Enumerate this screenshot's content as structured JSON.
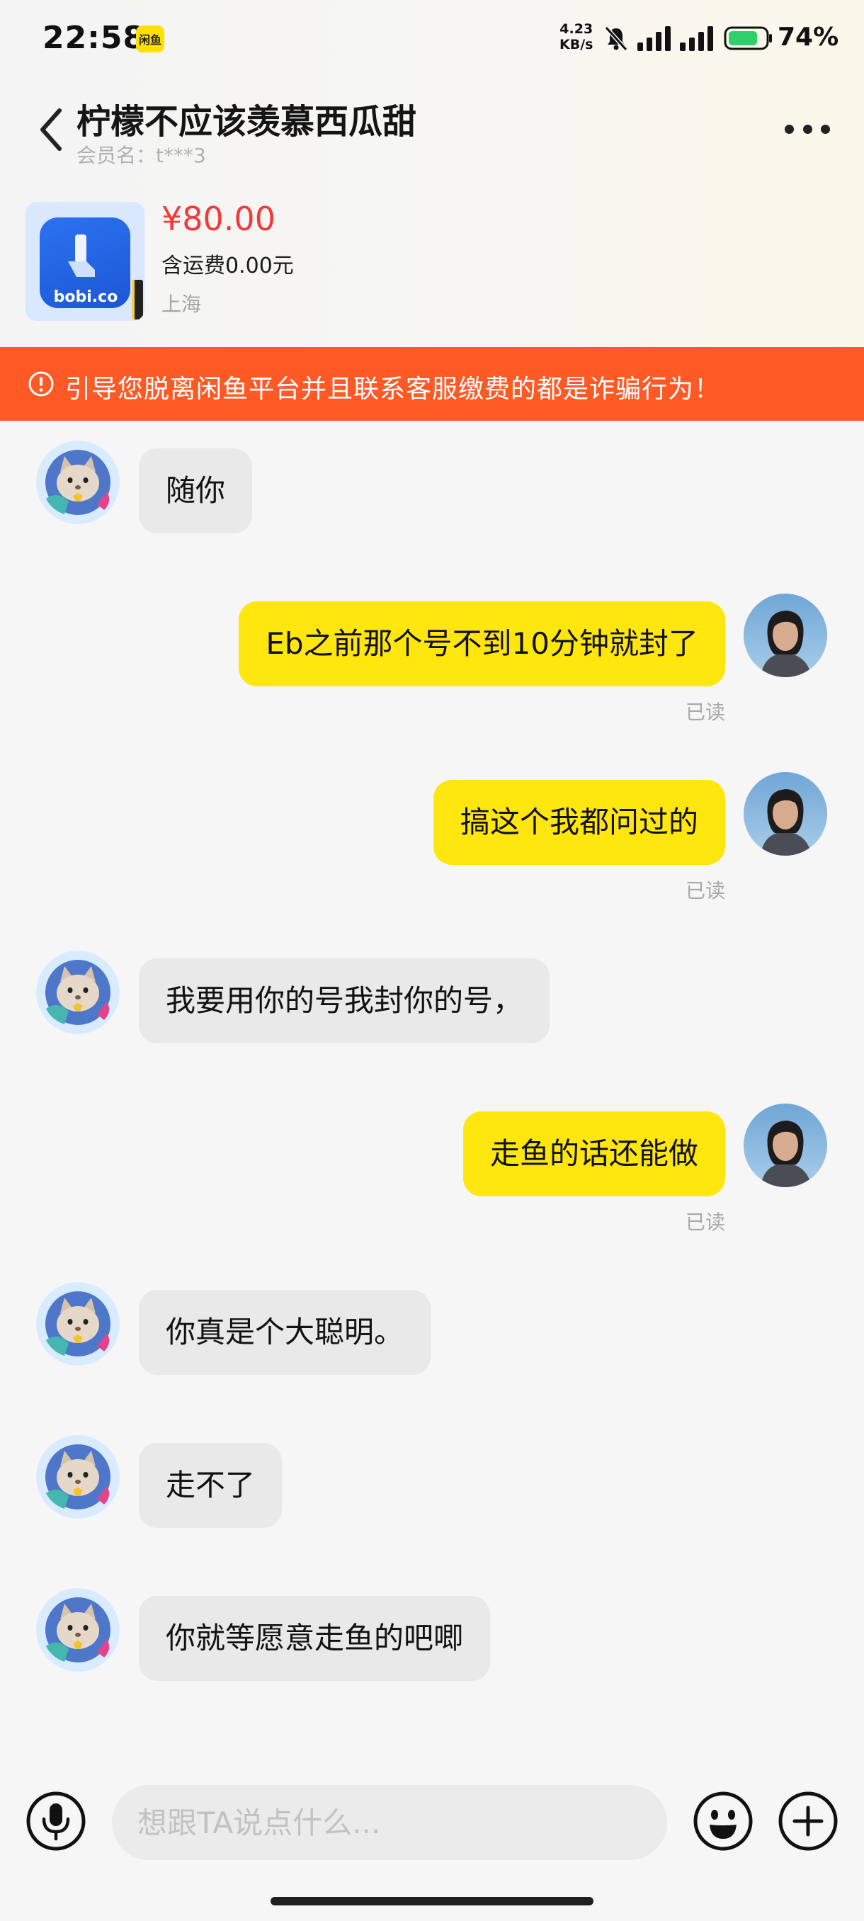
{
  "status_bar": {
    "time": "22:58",
    "app_badge": "闲鱼",
    "net_speed_value": "4.23",
    "net_speed_unit": "KB/s",
    "battery": "74%"
  },
  "header": {
    "title": "柠檬不应该羡慕西瓜甜",
    "member_name": "会员名：t***3"
  },
  "product": {
    "price": "¥80.00",
    "shipping": "含运费0.00元",
    "location": "上海",
    "thumb_text": "bobi.co"
  },
  "warning": {
    "text": "引导您脱离闲鱼平台并且联系客服缴费的都是诈骗行为！"
  },
  "messages": [
    {
      "side": "in",
      "text": "随你"
    },
    {
      "side": "out",
      "text": "Eb之前那个号不到10分钟就封了",
      "status": "已读"
    },
    {
      "side": "out",
      "text": "搞这个我都问过的",
      "status": "已读"
    },
    {
      "side": "in",
      "text": "我要用你的号我封你的号，"
    },
    {
      "side": "out",
      "text": "走鱼的话还能做",
      "status": "已读"
    },
    {
      "side": "in",
      "text": "你真是个大聪明。"
    },
    {
      "side": "in",
      "text": "走不了"
    },
    {
      "side": "in",
      "text": "你就等愿意走鱼的吧唧"
    }
  ],
  "input_bar": {
    "placeholder": "想跟TA说点什么..."
  },
  "colors": {
    "accent_yellow": "#ffe60f",
    "warning_orange": "#ff5a26",
    "price_red": "#ef3b3b"
  }
}
